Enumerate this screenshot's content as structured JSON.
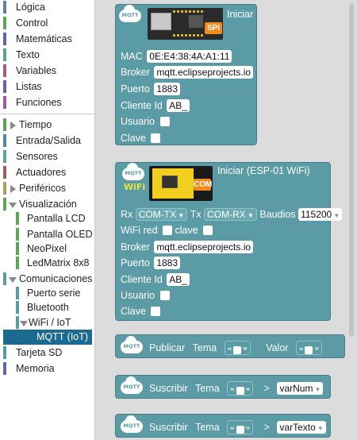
{
  "toolbox": {
    "categories": [
      {
        "label": "Lógica",
        "color": "#5c81a6"
      },
      {
        "label": "Control",
        "color": "#5ca65c"
      },
      {
        "label": "Matemáticas",
        "color": "#5c68a6"
      },
      {
        "label": "Texto",
        "color": "#5ba58c"
      },
      {
        "label": "Variables",
        "color": "#a55b80"
      },
      {
        "label": "Listas",
        "color": "#745ba5"
      },
      {
        "label": "Funciones",
        "color": "#995ba5"
      },
      {
        "label": "Tiempo",
        "color": "#5ca65c"
      },
      {
        "label": "Entrada/Salida",
        "color": "#5c81a6"
      },
      {
        "label": "Sensores",
        "color": "#5ba5a5"
      },
      {
        "label": "Actuadores",
        "color": "#a55b5b"
      },
      {
        "label": "Periféricos",
        "color": "#a5a55b"
      },
      {
        "label": "Visualización",
        "color": "#5ca65c"
      },
      {
        "label": "Pantalla LCD",
        "color": "#5ca65c"
      },
      {
        "label": "Pantalla OLED",
        "color": "#5ca65c"
      },
      {
        "label": "NeoPixel",
        "color": "#5ca65c"
      },
      {
        "label": "LedMatrix 8x8",
        "color": "#5ca65c"
      },
      {
        "label": "Comunicaciones",
        "color": "#5b9ba5"
      },
      {
        "label": "Puerto serie",
        "color": "#5b9ba5"
      },
      {
        "label": "Bluetooth",
        "color": "#5b9ba5"
      },
      {
        "label": "WiFi / IoT",
        "color": "#5b9ba5"
      },
      {
        "label": "MQTT (IoT)",
        "color": "#5b9ba5"
      },
      {
        "label": "Tarjeta SD",
        "color": "#5b9ba5"
      },
      {
        "label": "Memoria",
        "color": "#5c68a6"
      }
    ]
  },
  "icons": {
    "mqtt_logo": "MQTT",
    "wifi_logo": "WiFi",
    "spi_badge": "SPI",
    "com_badge": "COM"
  },
  "block1": {
    "title": "Iniciar",
    "mac_label": "MAC",
    "mac_value": "0E:E4:38:4A:A1:11",
    "broker_label": "Broker",
    "broker_value": "mqtt.eclipseprojects.io",
    "port_label": "Puerto",
    "port_value": "1883",
    "client_label": "Cliente Id",
    "client_value": "AB_",
    "user_label": "Usuario",
    "pass_label": "Clave"
  },
  "block2": {
    "title": "Iniciar (ESP-01 WiFi)",
    "rx_label": "Rx",
    "rx_value": "COM-TX",
    "tx_label": "Tx",
    "tx_value": "COM-RX",
    "baud_label": "Baudios",
    "baud_value": "115200",
    "wifi_label": "WiFi red",
    "key_label": "clave",
    "broker_label": "Broker",
    "broker_value": "mqtt.eclipseprojects.io",
    "port_label": "Puerto",
    "port_value": "1883",
    "client_label": "Cliente Id",
    "client_value": "AB_",
    "user_label": "Usuario",
    "pass_label": "Clave"
  },
  "block3": {
    "publish_label": "Publicar",
    "topic_label": "Tema",
    "value_label": "Valor"
  },
  "block4": {
    "subscribe_label": "Suscribir",
    "topic_label": "Tema",
    "arrow": ">",
    "var_value": "varNum"
  },
  "block5": {
    "subscribe_label": "Suscribir",
    "topic_label": "Tema",
    "arrow": ">",
    "var_value": "varTexto"
  }
}
